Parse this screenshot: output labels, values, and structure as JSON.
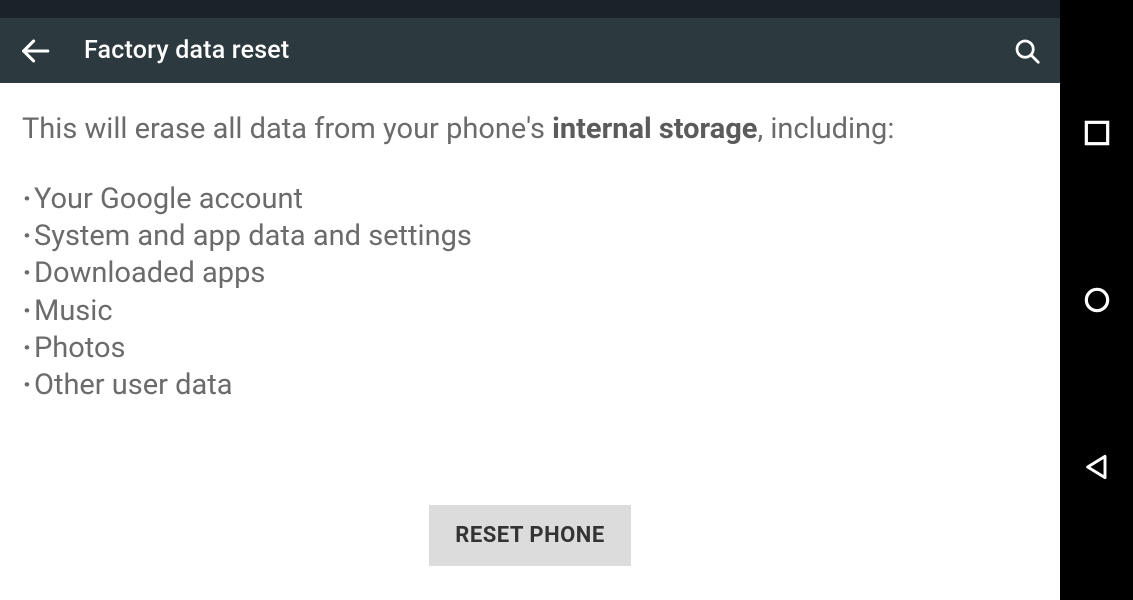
{
  "header": {
    "title": "Factory data reset"
  },
  "content": {
    "intro_prefix": "This will erase all data from your phone's ",
    "intro_bold": "internal storage",
    "intro_suffix": ", including:",
    "items": [
      "Your Google account",
      "System and app data and settings",
      "Downloaded apps",
      "Music",
      "Photos",
      "Other user data"
    ]
  },
  "button": {
    "reset_label": "RESET PHONE"
  },
  "colors": {
    "app_bar": "#2c3a40",
    "status_bar": "#1a2327",
    "nav_bar": "#000000",
    "text_muted": "#6b6b6b",
    "button_bg": "#dcdcdc"
  }
}
